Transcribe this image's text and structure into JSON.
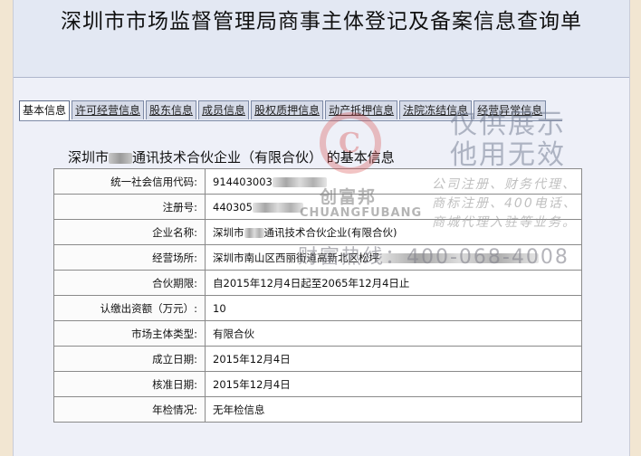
{
  "header": {
    "title": "深圳市市场监督管理局商事主体登记及备案信息查询单"
  },
  "tabs": [
    {
      "label": "基本信息",
      "active": true
    },
    {
      "label": "许可经营信息",
      "active": false
    },
    {
      "label": "股东信息",
      "active": false
    },
    {
      "label": "成员信息",
      "active": false
    },
    {
      "label": "股权质押信息",
      "active": false
    },
    {
      "label": "动产抵押信息",
      "active": false
    },
    {
      "label": "法院冻结信息",
      "active": false
    },
    {
      "label": "经营异常信息",
      "active": false
    }
  ],
  "section": {
    "title_prefix": "深圳市",
    "title_suffix": "通讯技术合伙企业（有限合伙） 的基本信息"
  },
  "fields": [
    {
      "label": "统一社会信用代码:",
      "value": "914403003"
    },
    {
      "label": "注册号:",
      "value": "440305"
    },
    {
      "label": "企业名称:",
      "value_prefix": "深圳市",
      "value_suffix": "通讯技术合伙企业(有限合伙)"
    },
    {
      "label": "经营场所:",
      "value": "深圳市南山区西丽街道高新北区松坪"
    },
    {
      "label": "合伙期限:",
      "value": "自2015年12月4日起至2065年12月4日止"
    },
    {
      "label": "认缴出资额（万元）:",
      "value": "10"
    },
    {
      "label": "市场主体类型:",
      "value": "有限合伙"
    },
    {
      "label": "成立日期:",
      "value": "2015年12月4日"
    },
    {
      "label": "核准日期:",
      "value": "2015年12月4日"
    },
    {
      "label": "年检情况:",
      "value": "无年检信息"
    }
  ],
  "watermark": {
    "logo_letter": "C",
    "brand_cn": "创富邦",
    "brand_en": "CHUANGFUBANG",
    "line1": "仅供展示",
    "line2": "他用无效",
    "small1": "公司注册、财务代理、",
    "small2": "商标注册、400电话、",
    "small3": "商城代理入驻等业务。",
    "hotline": "财富热线：400-068-4008"
  },
  "colors": {
    "page_bg": "#eef0f8",
    "header_bg": "#e3e8f3",
    "outer_bg": "#f2e6d2",
    "watermark_red": "#d64646"
  }
}
